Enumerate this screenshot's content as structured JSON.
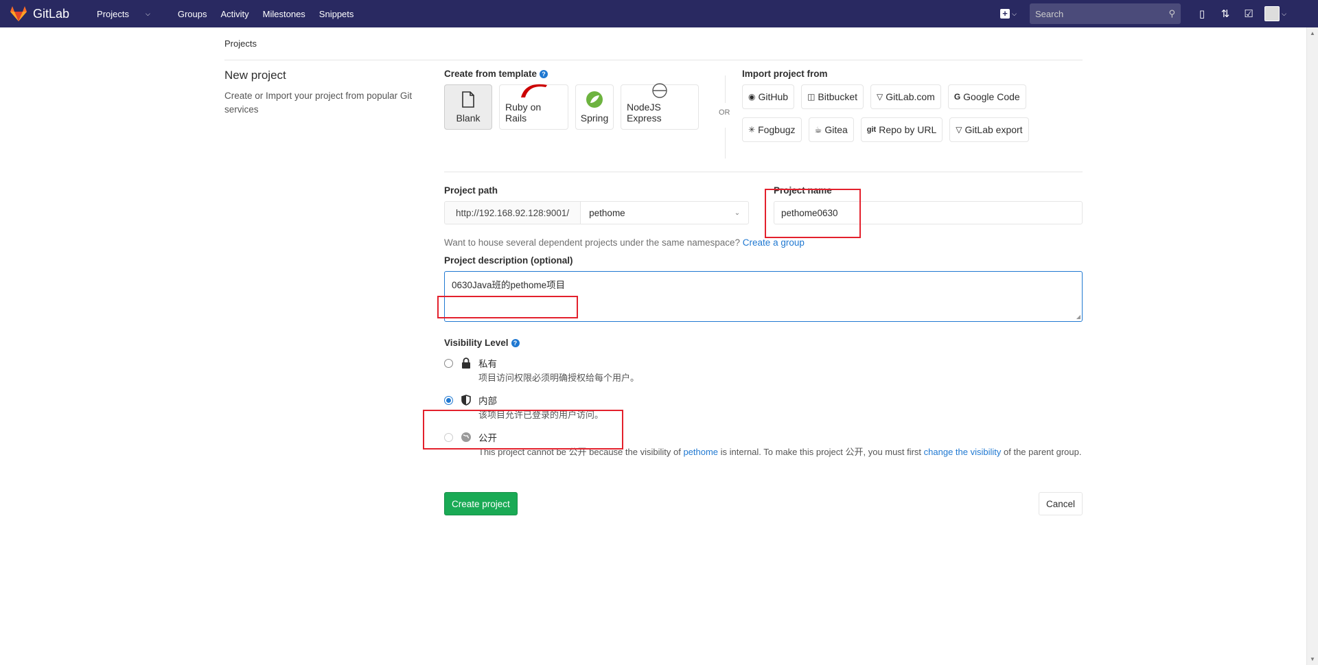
{
  "nav": {
    "brand": "GitLab",
    "links": [
      "Projects",
      "Groups",
      "Activity",
      "Milestones",
      "Snippets"
    ],
    "search_placeholder": "Search"
  },
  "breadcrumb": "Projects",
  "left": {
    "title": "New project",
    "description": "Create or Import your project from popular Git services"
  },
  "templates": {
    "label": "Create from template",
    "items": [
      "Blank",
      "Ruby on Rails",
      "Spring",
      "NodeJS Express"
    ],
    "or": "OR"
  },
  "imports": {
    "label": "Import project from",
    "row1": [
      "GitHub",
      "Bitbucket",
      "GitLab.com",
      "Google Code"
    ],
    "row2": [
      "Fogbugz",
      "Gitea",
      "Repo by URL",
      "GitLab export"
    ]
  },
  "path": {
    "label": "Project path",
    "prefix": "http://192.168.92.128:9001/",
    "namespace": "pethome"
  },
  "name": {
    "label": "Project name",
    "value": "pethome0630"
  },
  "namespace_hint": {
    "text": "Want to house several dependent projects under the same namespace?",
    "link": "Create a group"
  },
  "description": {
    "label": "Project description (optional)",
    "value": "0630Java班的pethome项目"
  },
  "visibility": {
    "label": "Visibility Level",
    "private_title": "私有",
    "private_desc": "项目访问权限必须明确授权给每个用户。",
    "internal_title": "内部",
    "internal_desc": "该项目允许已登录的用户访问。",
    "public_title": "公开",
    "public_desc_1": "This project cannot be 公开 because the visibility of",
    "public_link_1": "pethome",
    "public_desc_2": "is internal. To make this project 公开, you must first",
    "public_link_2": "change the visibility",
    "public_desc_3": "of the parent group."
  },
  "buttons": {
    "create": "Create project",
    "cancel": "Cancel"
  },
  "colors": {
    "nav_bg": "#292961",
    "accent": "#1f78d1",
    "success": "#1aaa55",
    "highlight": "#e3202c"
  }
}
